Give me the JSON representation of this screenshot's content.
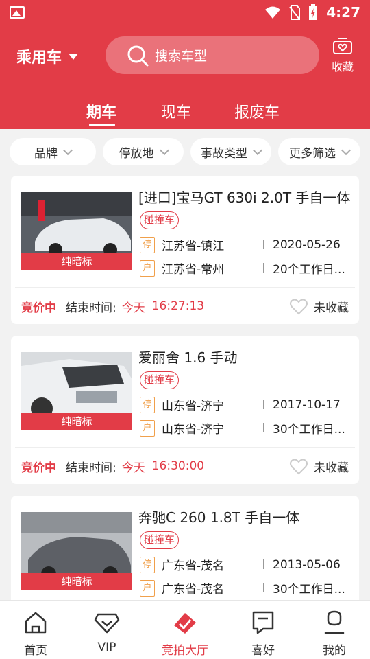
{
  "status_bar": {
    "time": "4:27"
  },
  "header": {
    "category": "乘用车",
    "search_placeholder": "搜索车型",
    "favorites_label": "收藏",
    "tabs": [
      {
        "label": "期车"
      },
      {
        "label": "现车"
      },
      {
        "label": "报废车"
      }
    ],
    "active_tab": "期车"
  },
  "filters": [
    {
      "label": "品牌"
    },
    {
      "label": "停放地"
    },
    {
      "label": "事故类型"
    },
    {
      "label": "更多筛选"
    }
  ],
  "listings": [
    {
      "title": "[进口]宝马GT 630i 2.0T 手自一体",
      "tag": "碰撞车",
      "badge": "纯暗标",
      "park_icon": "停",
      "park_location": "江苏省-镇江",
      "date": "2020-05-26",
      "reg_icon": "户",
      "reg_location": "江苏省-常州",
      "duration": "20个工作日...",
      "status": "竞价中",
      "end_label": "结束时间:",
      "end_day": "今天",
      "end_time": "16:27:13",
      "fav_label": "未收藏"
    },
    {
      "title": "爱丽舍 1.6 手动",
      "tag": "碰撞车",
      "badge": "纯暗标",
      "park_icon": "停",
      "park_location": "山东省-济宁",
      "date": "2017-10-17",
      "reg_icon": "户",
      "reg_location": "山东省-济宁",
      "duration": "30个工作日...",
      "status": "竞价中",
      "end_label": "结束时间:",
      "end_day": "今天",
      "end_time": "16:30:00",
      "fav_label": "未收藏"
    },
    {
      "title": "奔驰C 260 1.8T 手自一体",
      "tag": "碰撞车",
      "badge": "纯暗标",
      "park_icon": "停",
      "park_location": "广东省-茂名",
      "date": "2013-05-06",
      "reg_icon": "户",
      "reg_location": "广东省-茂名",
      "duration": "30个工作日...",
      "status": "",
      "end_label": "",
      "end_day": "",
      "end_time": "",
      "fav_label": ""
    }
  ],
  "bottom_nav": [
    {
      "label": "首页",
      "icon": "home-icon"
    },
    {
      "label": "VIP",
      "icon": "vip-icon"
    },
    {
      "label": "竞拍大厅",
      "icon": "auction-icon",
      "active": true
    },
    {
      "label": "喜好",
      "icon": "bookmark-icon"
    },
    {
      "label": "我的",
      "icon": "profile-icon"
    }
  ],
  "colors": {
    "accent": "#e23c47",
    "secondary": "#f0a04b"
  }
}
